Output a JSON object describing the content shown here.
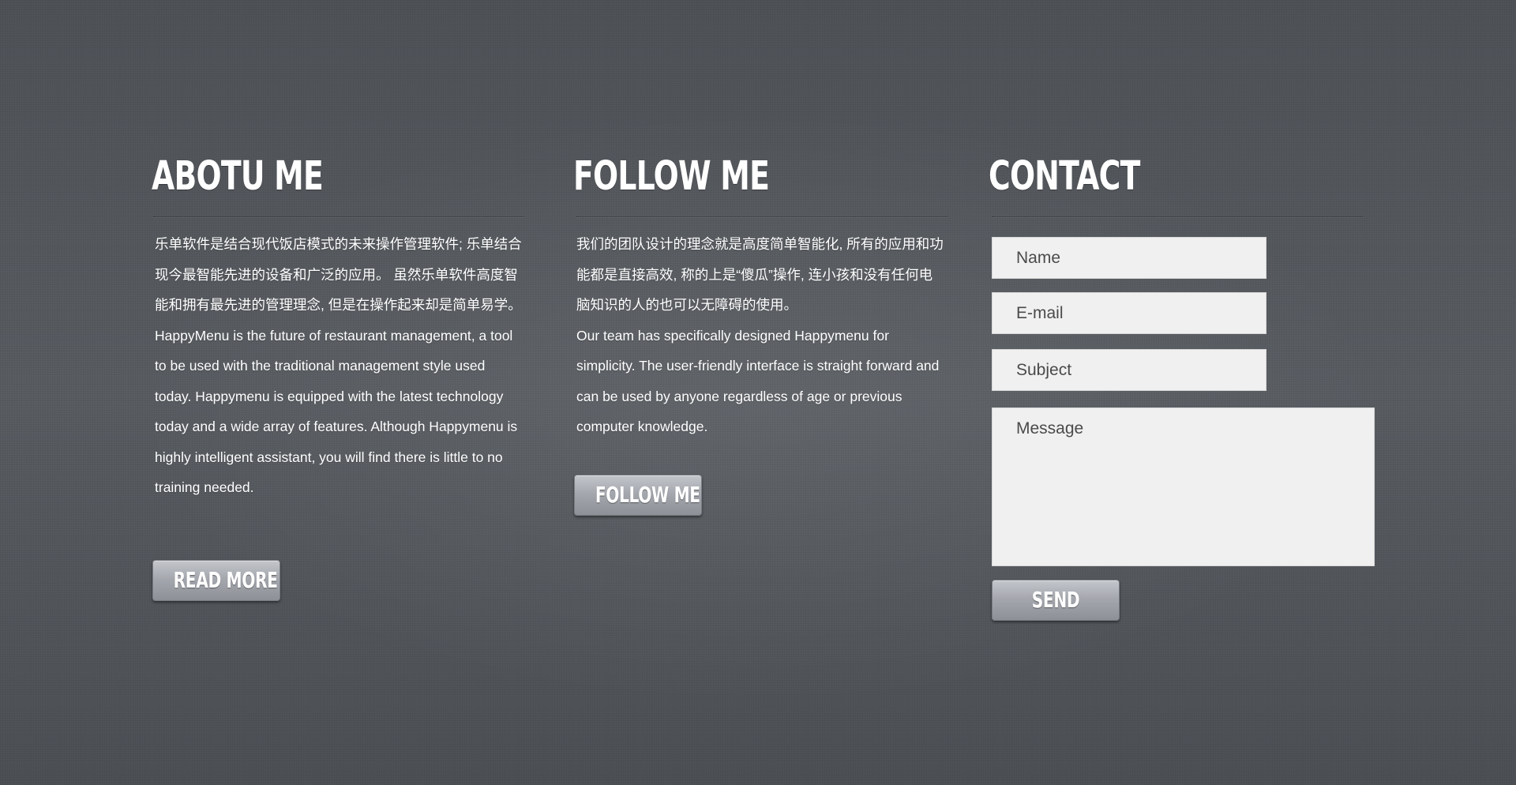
{
  "about": {
    "title": "ABOTU ME",
    "paragraph_zh": "乐单软件是结合现代饭店模式的未来操作管理软件; 乐单结合现今最智能先进的设备和广泛的应用。 虽然乐单软件高度智能和拥有最先进的管理理念, 但是在操作起来却是简单易学。",
    "paragraph_en": "HappyMenu is the future of restaurant management, a tool to be used with the traditional management style used today.  Happymenu is equipped with the latest technology today and a wide array of features. Although Happymenu is highly intelligent assistant, you will find there is little to no training needed.",
    "button_label": "READ MORE"
  },
  "follow": {
    "title": "FOLLOW ME",
    "paragraph_zh": "我们的团队设计的理念就是高度简单智能化, 所有的应用和功能都是直接高效, 称的上是“傻瓜”操作, 连小孩和没有任何电脑知识的人的也可以无障碍的使用。",
    "paragraph_en": "Our team has specifically designed Happymenu for simplicity.  The user-friendly interface is straight forward and can be used by anyone regardless of age or previous computer knowledge.",
    "button_label": "FOLLOW ME"
  },
  "contact": {
    "title": "CONTACT",
    "name_placeholder": "Name",
    "email_placeholder": "E-mail",
    "subject_placeholder": "Subject",
    "message_placeholder": "Message",
    "send_label": "SEND"
  }
}
